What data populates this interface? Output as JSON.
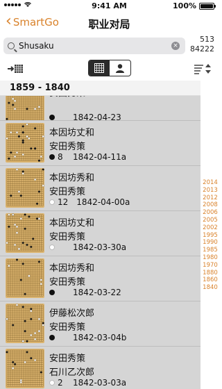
{
  "status": {
    "carrier_icon": "signal-dots",
    "time": "9:41 AM",
    "battery": "100%"
  },
  "nav": {
    "back_label": "SmartGo",
    "title": "职业对局"
  },
  "search": {
    "value": "Shusaku",
    "placeholder": "Search"
  },
  "counts": {
    "games": "513",
    "total": "84222"
  },
  "toolbar": {
    "left_icon": "import-board-icon",
    "seg_left_icon": "grid-icon",
    "seg_right_icon": "person-icon",
    "sort_icon": "sort-icon"
  },
  "list_header": "1859 - 1840",
  "rows": [
    {
      "black": "安田秀策",
      "white": "",
      "color": "black",
      "moves": "",
      "date": "1842-04-23"
    },
    {
      "black": "本因坊丈和",
      "white": "安田秀策",
      "color": "black",
      "moves": "8",
      "date": "1842-04-11a"
    },
    {
      "black": "本因坊秀和",
      "white": "安田秀策",
      "color": "white",
      "moves": "12",
      "date": "1842-04-00a"
    },
    {
      "black": "本因坊丈和",
      "white": "安田秀策",
      "color": "white",
      "moves": "",
      "date": "1842-03-30a"
    },
    {
      "black": "本因坊秀和",
      "white": "安田秀策",
      "color": "black",
      "moves": "",
      "date": "1842-03-22"
    },
    {
      "black": "伊藤松次郎",
      "white": "安田秀策",
      "color": "black",
      "moves": "",
      "date": "1842-03-04b"
    },
    {
      "black": "安田秀策",
      "white": "石川乙次郎",
      "color": "white",
      "moves": "2",
      "date": "1842-03-03a"
    }
  ],
  "years": [
    "2014",
    "2013",
    "2012",
    "2008",
    "2006",
    "2005",
    "2002",
    "1995",
    "1990",
    "1985",
    "1980",
    "1970",
    "1880",
    "1860",
    "1840"
  ],
  "colors": {
    "accent": "#d9822b",
    "board": "#dcb46e",
    "row_bg": "#d5d5d5"
  }
}
